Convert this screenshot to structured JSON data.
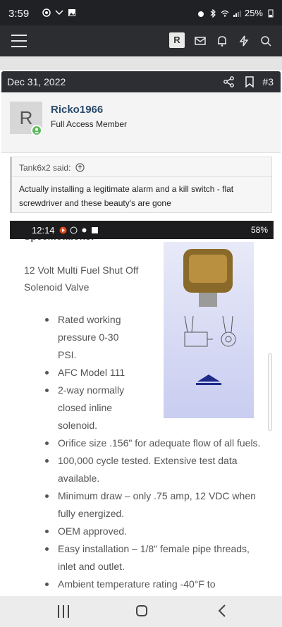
{
  "status_bar": {
    "time": "3:59",
    "battery": "25%"
  },
  "forum_bar": {
    "avatar_letter": "R"
  },
  "post": {
    "date": "Dec 31, 2022",
    "number": "#3",
    "author": {
      "avatar_letter": "R",
      "name": "Ricko1966",
      "role": "Full Access Member"
    },
    "quote": {
      "attribution": "Tank6x2 said:",
      "text": "Actually installing a legitimate alarm and a kill switch - flat screwdriver and these beauty's are gone"
    }
  },
  "embedded_screenshot": {
    "status_time": "12:14",
    "battery": "58%",
    "heading": "Specifications:",
    "product_title": "12 Volt Multi Fuel Shut Off Solenoid Valve",
    "bullets": [
      "Rated working pressure 0-30 PSI.",
      "AFC Model 111",
      "2-way normally closed inline solenoid.",
      "Orifice size .156\" for adequate flow of all fuels.",
      "100,000 cycle tested. Extensive test data available.",
      "Minimum draw – only .75 amp, 12 VDC when fully energized.",
      "OEM approved.",
      "Easy installation – 1/8\" female pipe threads, inlet and outlet.",
      "Ambient temperature rating -40°F to"
    ]
  },
  "icons": {
    "menu": "hamburger-icon",
    "mail": "mail-icon",
    "bell": "bell-icon",
    "bolt": "bolt-icon",
    "search": "search-icon",
    "share": "share-icon",
    "bookmark": "bookmark-icon",
    "quote_jump": "arrow-up-circle-icon"
  },
  "colors": {
    "appbar": "#2b2d31",
    "username": "#2a4a6b",
    "online": "#5cb85c"
  }
}
